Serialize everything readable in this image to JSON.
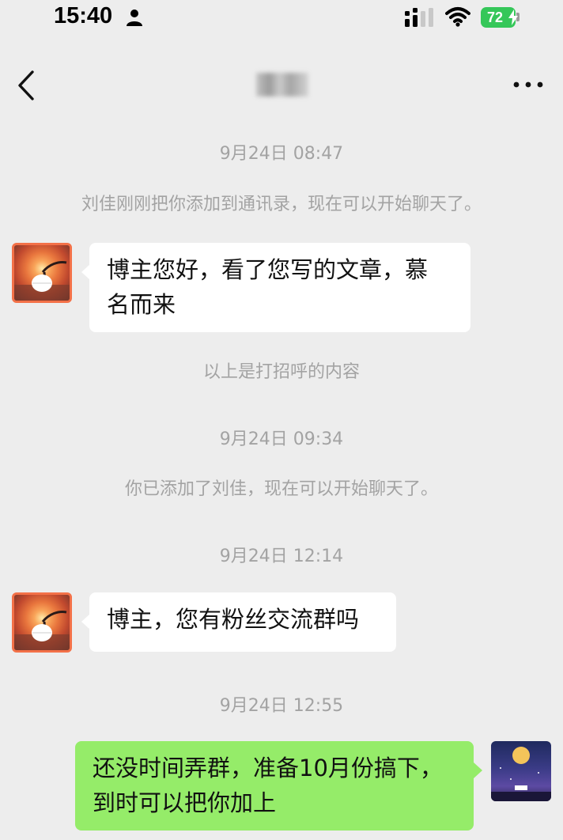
{
  "status_bar": {
    "time": "15:40",
    "battery": "72"
  },
  "nav": {
    "title": "刘佳"
  },
  "chat": {
    "timestamps": [
      "9月24日 08:47",
      "9月24日 09:34",
      "9月24日 12:14",
      "9月24日 12:55"
    ],
    "system": [
      "刘佳刚刚把你添加到通讯录，现在可以开始聊天了。",
      "以上是打招呼的内容",
      "你已添加了刘佳，现在可以开始聊天了。"
    ],
    "messages": [
      {
        "from": "刘佳",
        "text_line1": "博主您好，看了您写的文章，慕",
        "text_line2": "名而来"
      },
      {
        "from": "刘佳",
        "text_line1": "博主，您有粉丝交流群吗"
      },
      {
        "from": "me",
        "text_line1": "还没时间弄群，准备10月份搞下，",
        "text_line2": "到时可以把你加上"
      }
    ]
  },
  "colors": {
    "background": "#ededed",
    "bubble_in": "#ffffff",
    "bubble_out": "#95ec69",
    "battery": "#35c759",
    "meta_text": "#a3a3a3"
  },
  "icons": [
    "person-icon",
    "signal-icon",
    "wifi-icon",
    "bolt-icon",
    "back-icon",
    "more-icon"
  ]
}
